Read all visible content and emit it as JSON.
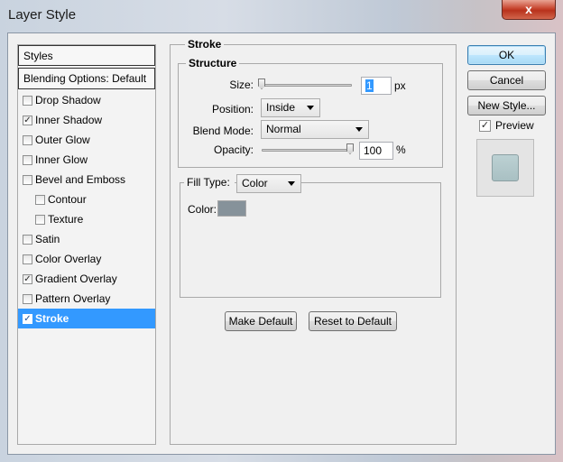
{
  "window": {
    "title": "Layer Style",
    "close_glyph": "x"
  },
  "styles_panel": {
    "header": "Styles",
    "blending_options": "Blending Options: Default",
    "items": [
      {
        "label": "Drop Shadow",
        "checked": false,
        "indent": false,
        "selected": false
      },
      {
        "label": "Inner Shadow",
        "checked": true,
        "indent": false,
        "selected": false
      },
      {
        "label": "Outer Glow",
        "checked": false,
        "indent": false,
        "selected": false
      },
      {
        "label": "Inner Glow",
        "checked": false,
        "indent": false,
        "selected": false
      },
      {
        "label": "Bevel and Emboss",
        "checked": false,
        "indent": false,
        "selected": false
      },
      {
        "label": "Contour",
        "checked": false,
        "indent": true,
        "selected": false
      },
      {
        "label": "Texture",
        "checked": false,
        "indent": true,
        "selected": false
      },
      {
        "label": "Satin",
        "checked": false,
        "indent": false,
        "selected": false
      },
      {
        "label": "Color Overlay",
        "checked": false,
        "indent": false,
        "selected": false
      },
      {
        "label": "Gradient Overlay",
        "checked": true,
        "indent": false,
        "selected": false
      },
      {
        "label": "Pattern Overlay",
        "checked": false,
        "indent": false,
        "selected": false
      },
      {
        "label": "Stroke",
        "checked": true,
        "indent": false,
        "selected": true
      }
    ]
  },
  "stroke": {
    "title": "Stroke",
    "structure": {
      "title": "Structure",
      "size_label": "Size:",
      "size_value": "1",
      "size_unit": "px",
      "position_label": "Position:",
      "position_value": "Inside",
      "blend_label": "Blend Mode:",
      "blend_value": "Normal",
      "opacity_label": "Opacity:",
      "opacity_value": "100",
      "opacity_unit": "%"
    },
    "fill": {
      "fill_type_label": "Fill Type:",
      "fill_type_value": "Color",
      "color_label": "Color:",
      "color_hex": "#86929a"
    },
    "make_default": "Make Default",
    "reset_default": "Reset to Default"
  },
  "buttons": {
    "ok": "OK",
    "cancel": "Cancel",
    "new_style": "New Style...",
    "preview_label": "Preview",
    "preview_checked": true
  },
  "check_glyph": "✓"
}
